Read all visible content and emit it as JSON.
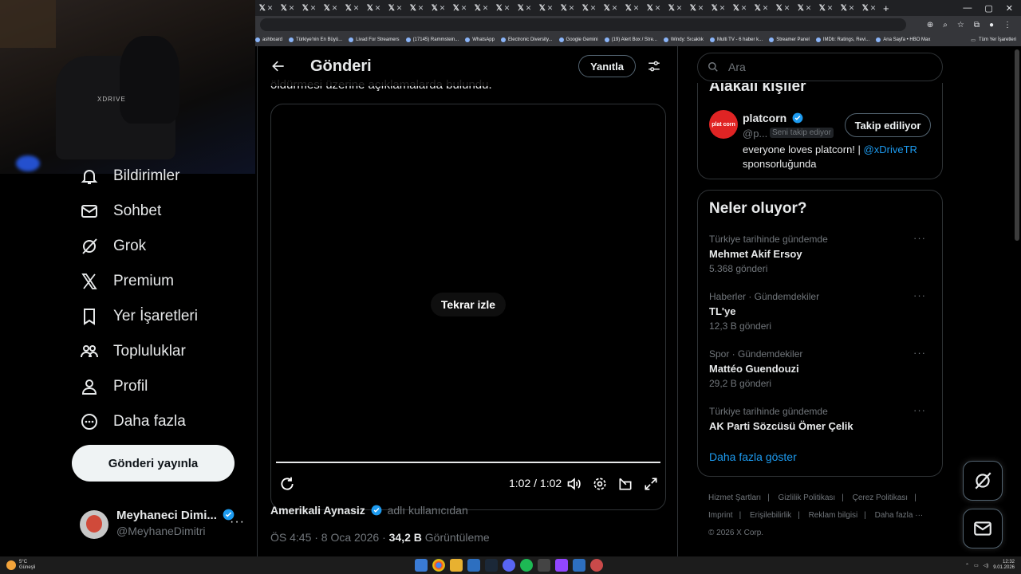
{
  "browser": {
    "tab_glyph": "𝕏",
    "tab_close": "✕",
    "tab_count": 29,
    "new_tab": "+",
    "bookmarks": [
      "ashboard",
      "Türkiye'nin En Büyü...",
      "Livad For Streamers",
      "(17145) Rammstein...",
      "WhatsApp",
      "Electronic Diversity...",
      "Google Gemini",
      "(19) Alert Box / Stre...",
      "Windy: Sıcaklık",
      "Multi TV - 6 haber k...",
      "Streamer Panel",
      "IMDb: Ratings, Revi...",
      "Ana Sayfa • HBO Max"
    ],
    "all_bookmarks": "Tüm Yer İşaretleri"
  },
  "webcam": {
    "logo_text": "XDRIVE"
  },
  "nav": {
    "items": [
      {
        "label": "Bildirimler",
        "icon": "bell-icon"
      },
      {
        "label": "Sohbet",
        "icon": "mail-icon"
      },
      {
        "label": "Grok",
        "icon": "grok-icon"
      },
      {
        "label": "Premium",
        "icon": "x-logo-icon"
      },
      {
        "label": "Yer İşaretleri",
        "icon": "bookmark-icon"
      },
      {
        "label": "Topluluklar",
        "icon": "communities-icon"
      },
      {
        "label": "Profil",
        "icon": "person-icon"
      },
      {
        "label": "Daha fazla",
        "icon": "more-circle-icon"
      }
    ],
    "post_button": "Gönderi yayınla"
  },
  "account": {
    "name": "Meyhaneci Dimi...",
    "handle": "@MeyhaneDimitri",
    "more": "···"
  },
  "main": {
    "title": "Gönderi",
    "reply_button": "Yanıtla",
    "cut_text": "öldürmesi üzerine açıklamalarda bulundu.",
    "video": {
      "replay_label": "Tekrar izle",
      "time": "1:02 / 1:02",
      "progress": 1.0
    },
    "byline_name": "Amerikali Aynasiz",
    "byline_rest": "adlı kullanıcıdan",
    "meta_time": "ÖS 4:45 · 8 Oca 2026 ·",
    "meta_views_count": "34,2 B",
    "meta_views_label": "Görüntüleme"
  },
  "search": {
    "placeholder": "Ara"
  },
  "related": {
    "title": "Alakalı kişiler",
    "person": {
      "avatar_text": "plat corn",
      "name": "platcorn",
      "handle": "@p...",
      "follows_you": "Seni takip ediyor",
      "follow_button": "Takip ediliyor",
      "bio_text": "everyone loves platcorn! |",
      "bio_mention": "@xDriveTR",
      "bio_suffix": "sponsorluğunda"
    }
  },
  "trends": {
    "title": "Neler oluyor?",
    "items": [
      {
        "context": "Türkiye tarihinde gündemde",
        "name": "Mehmet Akif Ersoy",
        "count": "5.368 gönderi"
      },
      {
        "context": "Haberler · Gündemdekiler",
        "name": "TL'ye",
        "count": "12,3 B gönderi"
      },
      {
        "context": "Spor · Gündemdekiler",
        "name": "Mattéo Guendouzi",
        "count": "29,2 B gönderi"
      },
      {
        "context": "Türkiye tarihinde gündemde",
        "name": "AK Parti Sözcüsü Ömer Çelik",
        "count": ""
      }
    ],
    "more_glyph": "···",
    "show_more": "Daha fazla göster"
  },
  "footer": {
    "links": [
      "Hizmet Şartları",
      "|",
      "Gizlilik Politikası",
      "|",
      "Çerez Politikası",
      "|",
      "Imprint",
      "|",
      "Erişilebilirlik",
      "|",
      "Reklam bilgisi",
      "|",
      "Daha fazla ···"
    ],
    "copyright": "© 2026 X Corp."
  },
  "taskbar": {
    "weather_temp": "5°C",
    "weather_desc": "Güneşli",
    "time": "12:32",
    "date": "9.01.2026"
  },
  "colors": {
    "accent": "#1d9bf0",
    "verified": "#1d9bf0",
    "post_button_bg": "#eff3f4"
  }
}
